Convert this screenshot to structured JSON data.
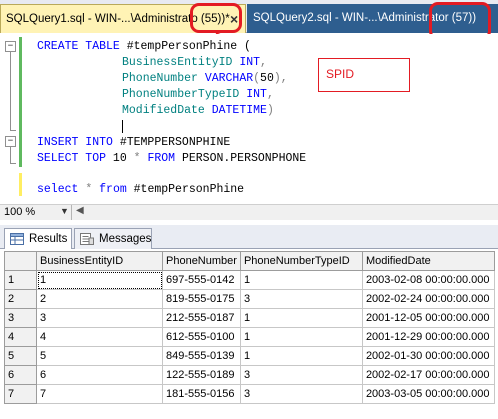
{
  "tabs": {
    "active": {
      "title": "SQLQuery1.sql - WIN-...\\Administrato",
      "spid": "(55))*",
      "close": "×"
    },
    "inactive": {
      "title": "SQLQuery2.sql - WIN-...\\Administrator",
      "spid": "(57))"
    }
  },
  "annotation": {
    "label": "SPID",
    "color": "#e31b23"
  },
  "editor": {
    "collapse_glyph": "−",
    "create": {
      "kw1": "CREATE TABLE",
      "name": " #tempPersonPhine (",
      "col1": "BusinessEntityID",
      "col1_type": " INT",
      "col2": "PhoneNumber",
      "col2_type": " VARCHAR",
      "col2_len": "50",
      "col3": "PhoneNumberTypeID",
      "col3_type": " INT",
      "col4": "ModifiedDate",
      "col4_type": " DATETIME",
      "open_paren": "(",
      "close_paren": ")",
      "comma": ",",
      "end": ")"
    },
    "insert": {
      "kw": "INSERT INTO",
      "target": " #TEMPPERSONPHINE"
    },
    "select1": {
      "kw1": "SELECT TOP",
      "num": " 10",
      "star": " *",
      "kw2": " FROM",
      "src": " PERSON.PERSONPHONE"
    },
    "select2": {
      "kw1": "select",
      "star": " *",
      "kw2": " from",
      "src": " #tempPersonPhine"
    }
  },
  "zoom": {
    "level": "100 %"
  },
  "results": {
    "tab_results": "Results",
    "tab_messages": "Messages",
    "columns": [
      "BusinessEntityID",
      "PhoneNumber",
      "PhoneNumberTypeID",
      "ModifiedDate"
    ],
    "rows": [
      {
        "n": "1",
        "id": "1",
        "phone": "697-555-0142",
        "type": "1",
        "date": "2003-02-08 00:00:00.000"
      },
      {
        "n": "2",
        "id": "2",
        "phone": "819-555-0175",
        "type": "3",
        "date": "2002-02-24 00:00:00.000"
      },
      {
        "n": "3",
        "id": "3",
        "phone": "212-555-0187",
        "type": "1",
        "date": "2001-12-05 00:00:00.000"
      },
      {
        "n": "4",
        "id": "4",
        "phone": "612-555-0100",
        "type": "1",
        "date": "2001-12-29 00:00:00.000"
      },
      {
        "n": "5",
        "id": "5",
        "phone": "849-555-0139",
        "type": "1",
        "date": "2002-01-30 00:00:00.000"
      },
      {
        "n": "6",
        "id": "6",
        "phone": "122-555-0189",
        "type": "3",
        "date": "2002-02-17 00:00:00.000"
      },
      {
        "n": "7",
        "id": "7",
        "phone": "181-555-0156",
        "type": "3",
        "date": "2003-03-05 00:00:00.000"
      }
    ]
  }
}
